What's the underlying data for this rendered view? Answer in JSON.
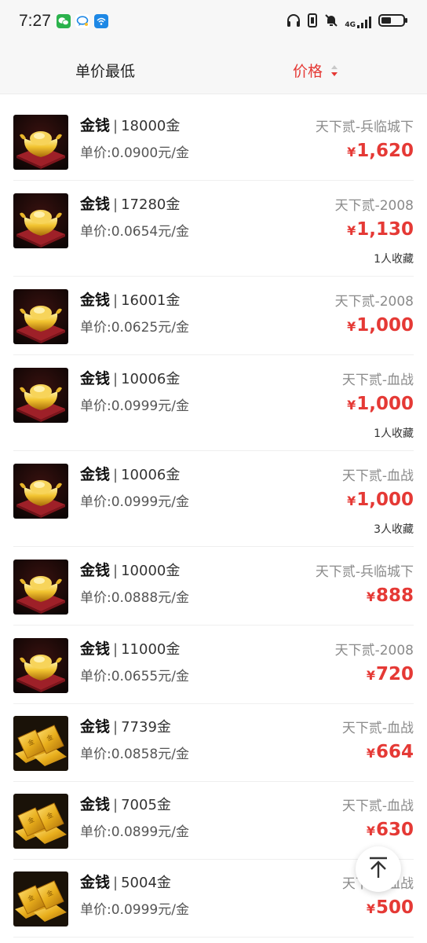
{
  "status_bar": {
    "time": "7:27",
    "icons_left": [
      "wechat-icon",
      "chat-bubble-icon",
      "wifi-app-icon"
    ],
    "icons_right": [
      "headphones-icon",
      "vibrate-icon",
      "mute-icon",
      "signal-4g-icon",
      "battery-icon"
    ],
    "network": "4G"
  },
  "sort_bar": {
    "left_label": "单价最低",
    "right_label": "价格",
    "accent_color": "#e53935"
  },
  "listings": [
    {
      "name": "金钱",
      "amount": "18000金",
      "unit_price": "单价:0.0900元/金",
      "server": "天下贰-兵临城下",
      "currency": "¥",
      "price": "1,620",
      "favorites": "",
      "thumb": "ingot"
    },
    {
      "name": "金钱",
      "amount": "17280金",
      "unit_price": "单价:0.0654元/金",
      "server": "天下贰-2008",
      "currency": "¥",
      "price": "1,130",
      "favorites": "1人收藏",
      "thumb": "ingot"
    },
    {
      "name": "金钱",
      "amount": "16001金",
      "unit_price": "单价:0.0625元/金",
      "server": "天下贰-2008",
      "currency": "¥",
      "price": "1,000",
      "favorites": "",
      "thumb": "ingot"
    },
    {
      "name": "金钱",
      "amount": "10006金",
      "unit_price": "单价:0.0999元/金",
      "server": "天下贰-血战",
      "currency": "¥",
      "price": "1,000",
      "favorites": "1人收藏",
      "thumb": "ingot"
    },
    {
      "name": "金钱",
      "amount": "10006金",
      "unit_price": "单价:0.0999元/金",
      "server": "天下贰-血战",
      "currency": "¥",
      "price": "1,000",
      "favorites": "3人收藏",
      "thumb": "ingot"
    },
    {
      "name": "金钱",
      "amount": "10000金",
      "unit_price": "单价:0.0888元/金",
      "server": "天下贰-兵临城下",
      "currency": "¥",
      "price": "888",
      "favorites": "",
      "thumb": "ingot"
    },
    {
      "name": "金钱",
      "amount": "11000金",
      "unit_price": "单价:0.0655元/金",
      "server": "天下贰-2008",
      "currency": "¥",
      "price": "720",
      "favorites": "",
      "thumb": "ingot"
    },
    {
      "name": "金钱",
      "amount": "7739金",
      "unit_price": "单价:0.0858元/金",
      "server": "天下贰-血战",
      "currency": "¥",
      "price": "664",
      "favorites": "",
      "thumb": "bars"
    },
    {
      "name": "金钱",
      "amount": "7005金",
      "unit_price": "单价:0.0899元/金",
      "server": "天下贰-血战",
      "currency": "¥",
      "price": "630",
      "favorites": "",
      "thumb": "bars"
    },
    {
      "name": "金钱",
      "amount": "5004金",
      "unit_price": "单价:0.0999元/金",
      "server": "天下贰-血战",
      "currency": "¥",
      "price": "500",
      "favorites": "",
      "thumb": "bars"
    }
  ],
  "back_to_top": {
    "icon": "arrow-to-top-icon"
  }
}
